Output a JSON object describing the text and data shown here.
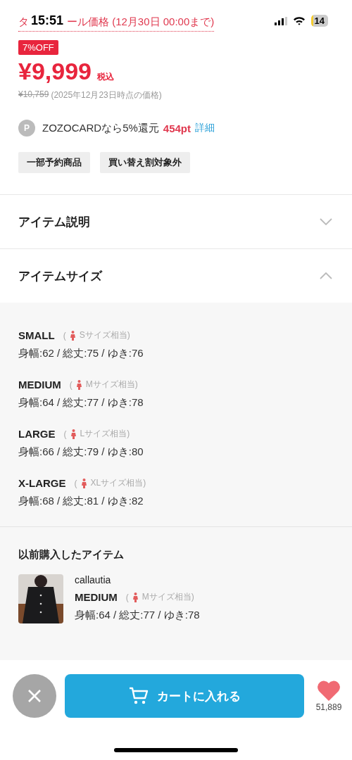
{
  "status_bar": {
    "time": "15:51",
    "battery": "14"
  },
  "sale_label": {
    "start": "タ",
    "end": "ール価格 (12月30日 00:00まで)"
  },
  "discount_badge": "7%OFF",
  "price": "¥9,999",
  "tax_label": "税込",
  "original_price": "¥10,759",
  "price_note": "(2025年12月23日時点の価格)",
  "points": {
    "icon": "P",
    "text": "ZOZOCARDなら5%還元",
    "amount": "454pt",
    "link": "詳細"
  },
  "tags": [
    "一部予約商品",
    "買い替え割対象外"
  ],
  "sections": [
    {
      "title": "アイテム説明",
      "expanded": false
    },
    {
      "title": "アイテムサイズ",
      "expanded": true
    }
  ],
  "sizes": [
    {
      "name": "SMALL",
      "open": "(",
      "fit": "Sサイズ相当)",
      "measurements": "身幅:62 / 総丈:75 / ゆき:76"
    },
    {
      "name": "MEDIUM",
      "open": "(",
      "fit": "Mサイズ相当)",
      "measurements": "身幅:64 / 総丈:77 / ゆき:78"
    },
    {
      "name": "LARGE",
      "open": "(",
      "fit": "Lサイズ相当)",
      "measurements": "身幅:66 / 総丈:79 / ゆき:80"
    },
    {
      "name": "X-LARGE",
      "open": "(",
      "fit": "XLサイズ相当)",
      "measurements": "身幅:68 / 総丈:81 / ゆき:82"
    }
  ],
  "previous": {
    "title": "以前購入したアイテム",
    "brand": "callautia",
    "size": {
      "name": "MEDIUM",
      "open": "(",
      "fit": "Mサイズ相当)",
      "measurements": "身幅:64 / 総丈:77 / ゆき:78"
    }
  },
  "bottom_bar": {
    "cart_button": "カートに入れる",
    "favorites": "51,889"
  }
}
